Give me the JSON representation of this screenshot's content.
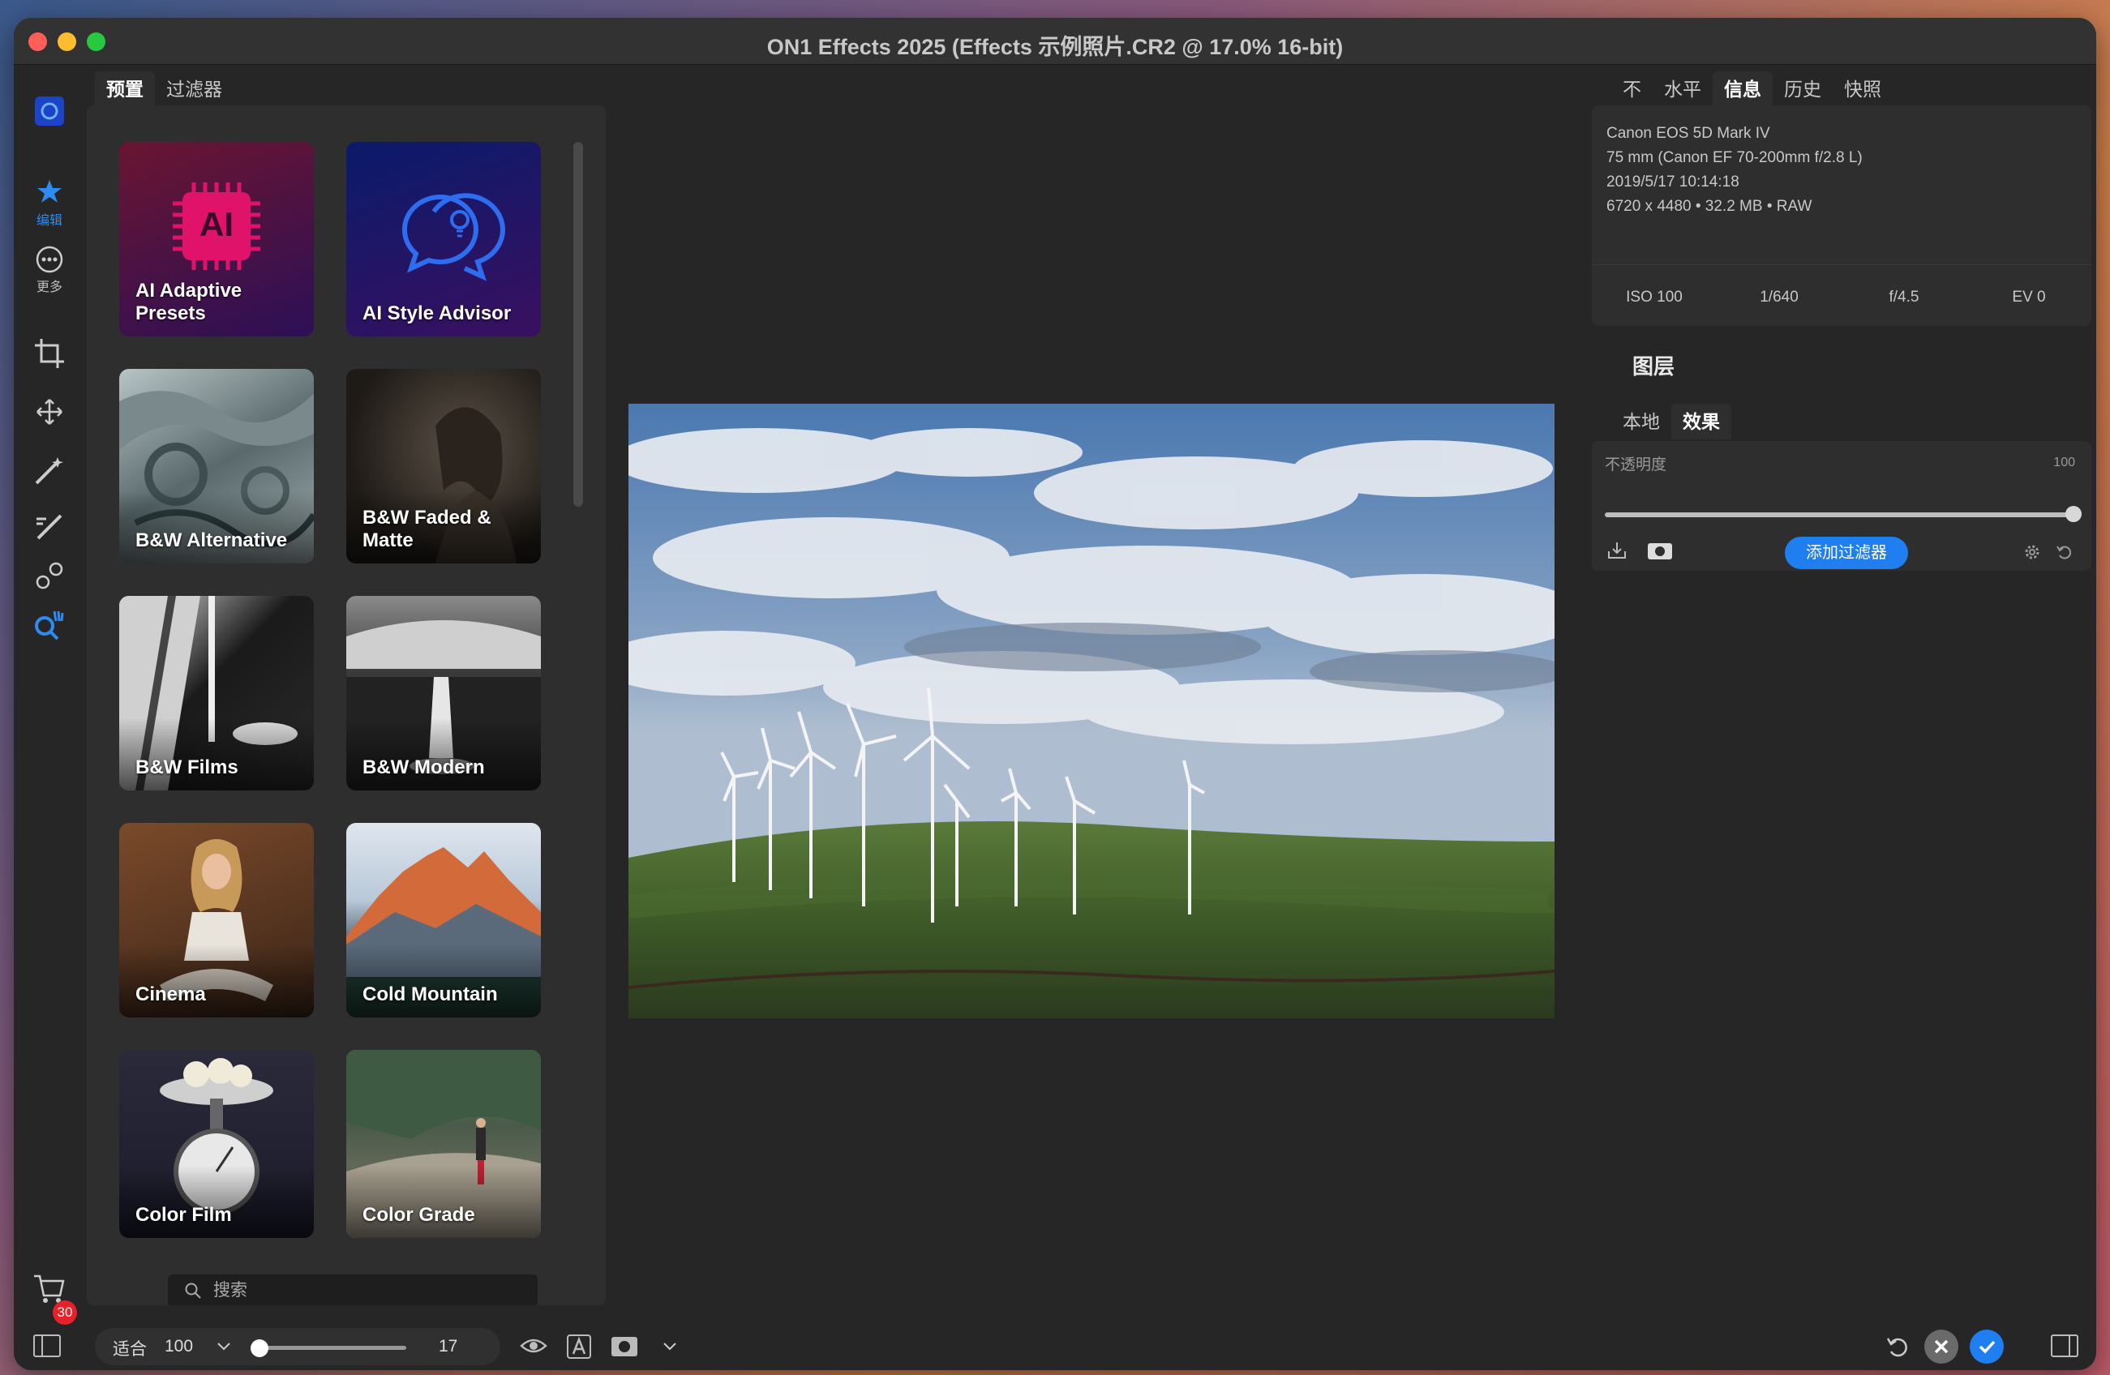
{
  "window": {
    "title": "ON1 Effects 2025 (Effects 示例照片.CR2 @ 17.0% 16-bit)"
  },
  "rail": {
    "edit_label": "编辑",
    "more_label": "更多",
    "cart_badge": "30"
  },
  "left_tabs": [
    "预置",
    "过滤器"
  ],
  "presets": [
    {
      "label": "AI Adaptive Presets"
    },
    {
      "label": "AI Style Advisor"
    },
    {
      "label": "B&W Alternative"
    },
    {
      "label": "B&W Faded & Matte"
    },
    {
      "label": "B&W Films"
    },
    {
      "label": "B&W Modern"
    },
    {
      "label": "Cinema"
    },
    {
      "label": "Cold Mountain"
    },
    {
      "label": "Color Film"
    },
    {
      "label": "Color Grade"
    }
  ],
  "search": {
    "placeholder": "搜索"
  },
  "right_tabs": [
    "不",
    "水平",
    "信息",
    "历史",
    "快照"
  ],
  "info": {
    "camera": "Canon EOS 5D Mark IV",
    "lens": "75 mm (Canon EF 70-200mm f/2.8 L)",
    "datetime": "2019/5/17  10:14:18",
    "dimensions": "6720 x 4480 • 32.2 MB • RAW",
    "iso": "ISO 100",
    "shutter": "1/640",
    "aperture": "f/4.5",
    "ev": "EV 0"
  },
  "layers": {
    "title": "图层",
    "tabs": [
      "本地",
      "效果"
    ],
    "opacity_label": "不透明度",
    "opacity_value": "100",
    "add_filter": "添加过滤器"
  },
  "bottom": {
    "fit_label": "适合",
    "zoom_value": "100",
    "zoom_number": "17",
    "zoom_fraction": 0.0
  },
  "colors": {
    "accent": "#1f7ff0",
    "badge": "#e8202a"
  }
}
